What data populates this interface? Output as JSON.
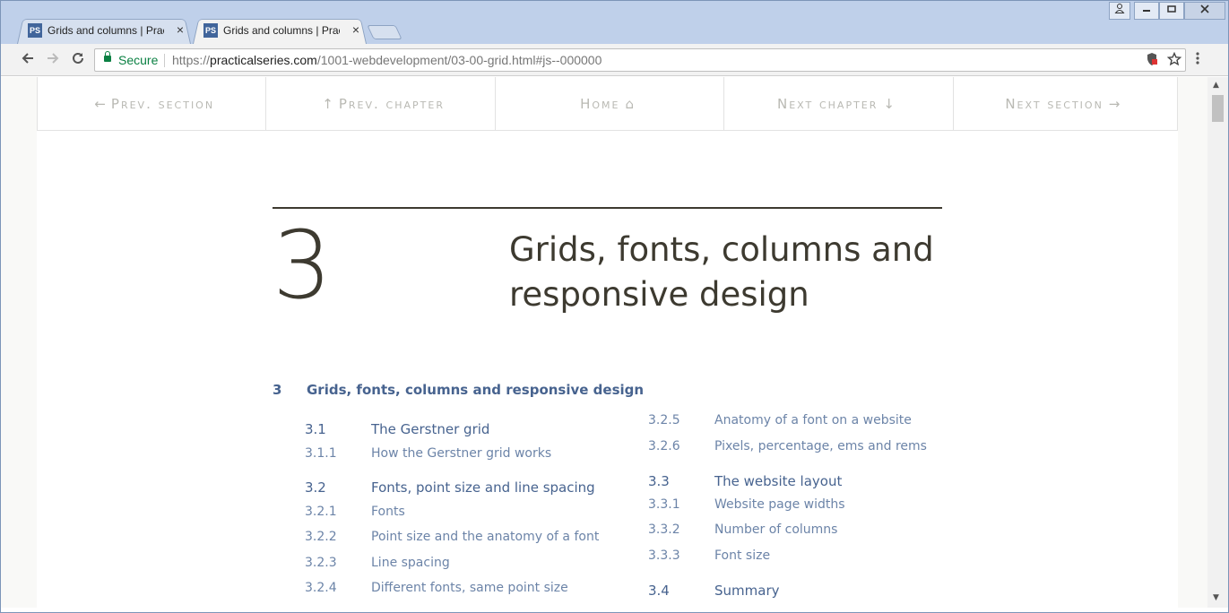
{
  "browser": {
    "tabs": [
      {
        "favicon": "PS",
        "title": "Grids and columns | Practical",
        "active": false
      },
      {
        "favicon": "PS",
        "title": "Grids and columns | Practical",
        "active": true
      }
    ],
    "tab_close": "×",
    "address": {
      "secure_label": "Secure",
      "url_scheme": "https://",
      "url_host": "practicalseries.com",
      "url_path": "/1001-webdevelopment/03-00-grid.html#js--000000"
    },
    "icons": {
      "back": "back-arrow-icon",
      "forward": "forward-arrow-icon",
      "reload": "reload-icon",
      "shield": "shield-blocked-icon",
      "star": "bookmark-star-icon",
      "menu": "kebab-menu-icon"
    }
  },
  "nav": {
    "prev_section": "Prev. section",
    "prev_chapter": "Prev. chapter",
    "home": "Home",
    "next_chapter": "Next chapter",
    "next_section": "Next section"
  },
  "chapter": {
    "number": "3",
    "title": "Grids, fonts, columns and responsive design"
  },
  "toc": {
    "top": {
      "num": "3",
      "label": "Grids, fonts, columns and responsive design"
    },
    "left": [
      {
        "num": "3.1",
        "label": "The Gerstner grid",
        "level": "h2"
      },
      {
        "num": "3.1.1",
        "label": "How the Gerstner grid works",
        "level": "h3"
      },
      {
        "num": "3.2",
        "label": "Fonts, point size and line spacing",
        "level": "h2"
      },
      {
        "num": "3.2.1",
        "label": "Fonts",
        "level": "h3"
      },
      {
        "num": "3.2.2",
        "label": "Point size and the anatomy of a font",
        "level": "h3"
      },
      {
        "num": "3.2.3",
        "label": "Line spacing",
        "level": "h3"
      },
      {
        "num": "3.2.4",
        "label": "Different fonts, same point size",
        "level": "h3"
      }
    ],
    "right": [
      {
        "num": "3.2.5",
        "label": "Anatomy of a font on a website",
        "level": "h3"
      },
      {
        "num": "3.2.6",
        "label": "Pixels, percentage, ems and rems",
        "level": "h3"
      },
      {
        "num": "3.3",
        "label": "The website layout",
        "level": "h2"
      },
      {
        "num": "3.3.1",
        "label": "Website page widths",
        "level": "h3"
      },
      {
        "num": "3.3.2",
        "label": "Number of columns",
        "level": "h3"
      },
      {
        "num": "3.3.3",
        "label": "Font size",
        "level": "h3"
      },
      {
        "num": "3.4",
        "label": "Summary",
        "level": "h2"
      }
    ]
  }
}
